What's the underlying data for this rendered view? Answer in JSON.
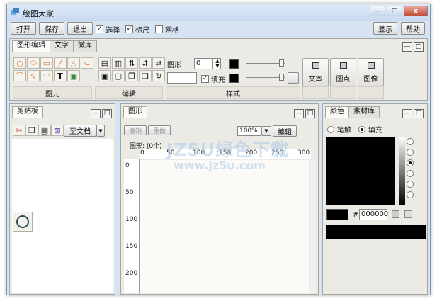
{
  "window": {
    "title": "绘图大家"
  },
  "window_controls": {
    "minimize": "—",
    "maximize": "□",
    "close": "x"
  },
  "mainbar": {
    "open": "打开",
    "save": "保存",
    "exit": "退出",
    "select_label": "选择",
    "ruler_label": "标尺",
    "grid_label": "网格",
    "show": "显示",
    "help": "帮助",
    "select_checked": true,
    "ruler_checked": true,
    "grid_checked": false
  },
  "ribbon": {
    "tabs": [
      "图形编辑",
      "文字",
      "微库"
    ],
    "groups": {
      "primitives": "图元",
      "edit": "编辑",
      "style": "样式"
    },
    "shape_label": "图形",
    "shape_value": "0",
    "fill_label": "填充",
    "fill_checked": true,
    "big_buttons": [
      "文本",
      "图点",
      "图像"
    ],
    "tool_glyphs": [
      "○",
      "⬭",
      "▭",
      "╱",
      "△",
      "⊂",
      "⌒",
      "∿",
      "◠",
      "T",
      "▣"
    ]
  },
  "clipboard": {
    "tab": "剪贴板",
    "to_doc": "至文档",
    "dropdown": "▼"
  },
  "canvas": {
    "tab": "图形",
    "undo": "撤销",
    "redo": "重做",
    "zoom": "100%",
    "edit": "编辑",
    "status": "图形: (0个)",
    "h_ticks": [
      "0",
      "50",
      "100",
      "150",
      "200",
      "250",
      "300"
    ],
    "v_ticks": [
      "0",
      "50",
      "100",
      "150",
      "200"
    ]
  },
  "color_panel": {
    "tabs": [
      "颜色",
      "素材库"
    ],
    "stroke": "笔触",
    "fill": "填充",
    "hex_prefix": "#",
    "hex": "000000"
  },
  "watermark": {
    "line1": "JZ5U绿色下载",
    "line2": "www.jz5u.com"
  },
  "colors": {
    "accent": "#d6e3f1",
    "panel": "#eceae4",
    "black": "#000000"
  }
}
